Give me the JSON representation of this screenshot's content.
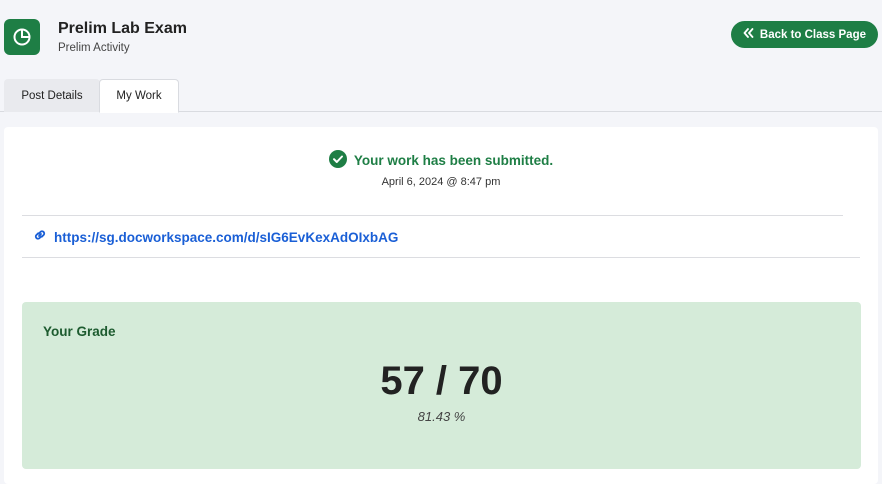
{
  "header": {
    "title": "Prelim Lab Exam",
    "subtitle": "Prelim Activity",
    "back_button_label": "Back to Class Page",
    "app_icon": "pie-chart-icon",
    "brand_color": "#1e7e45"
  },
  "tabs": [
    {
      "label": "Post Details",
      "active": false
    },
    {
      "label": "My Work",
      "active": true
    }
  ],
  "submission": {
    "status_text": "Your work has been submitted.",
    "date": "April 6, 2024 @ 8:47 pm",
    "status_icon": "check-circle-icon",
    "link_icon": "link-icon",
    "link": "https://sg.docworkspace.com/d/sIG6EvKexAdOIxbAG"
  },
  "grade": {
    "label": "Your Grade",
    "score": "57 / 70",
    "percent": "81.43 %",
    "background_color": "#d5ebd9"
  }
}
